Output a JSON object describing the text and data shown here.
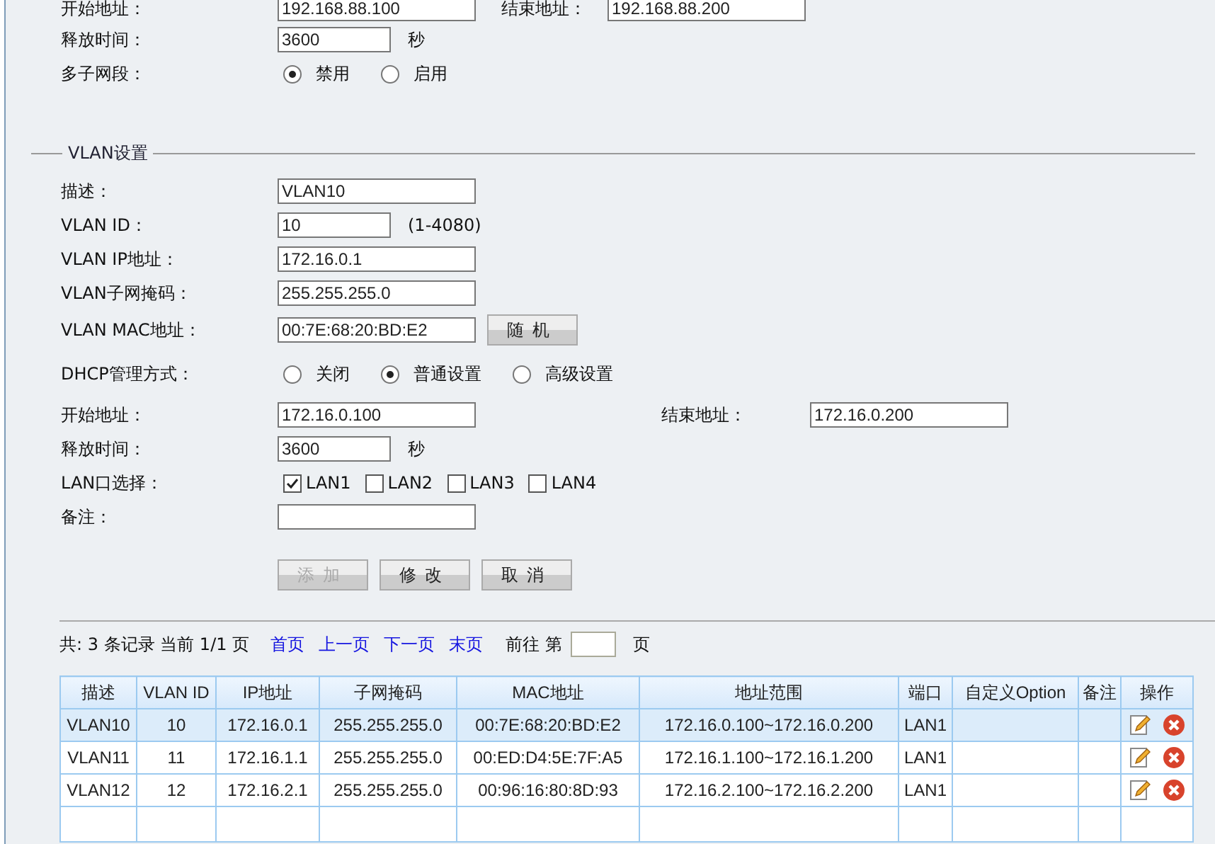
{
  "dhcp_basic": {
    "start_label": "开始地址：",
    "start_value": "192.168.88.100",
    "end_label": "结束地址：",
    "end_value": "192.168.88.200",
    "lease_label": "释放时间：",
    "lease_value": "3600",
    "lease_unit": "秒",
    "multi_label": "多子网段：",
    "multi_options": [
      {
        "label": "禁用",
        "selected": true
      },
      {
        "label": "启用",
        "selected": false
      }
    ]
  },
  "vlan": {
    "legend": "VLAN设置",
    "rows": [
      {
        "kind": "text",
        "label": "描述：",
        "value": "VLAN10"
      },
      {
        "kind": "short",
        "label": "VLAN ID：",
        "value": "10",
        "hint": "(1-4080)"
      },
      {
        "kind": "text",
        "label": "VLAN IP地址：",
        "value": "172.16.0.1"
      },
      {
        "kind": "text",
        "label": "VLAN子网掩码：",
        "value": "255.255.255.0"
      },
      {
        "kind": "button",
        "label": "VLAN MAC地址：",
        "value": "00:7E:68:20:BD:E2",
        "button": "随机"
      },
      {
        "kind": "radio",
        "label": "DHCP管理方式：",
        "options": [
          {
            "label": "关闭",
            "selected": false
          },
          {
            "label": "普通设置",
            "selected": true
          },
          {
            "label": "高级设置",
            "selected": false
          }
        ]
      },
      {
        "kind": "pair",
        "label": "开始地址：",
        "value": "172.16.0.100",
        "end_label": "结束地址：",
        "end_value": "172.16.0.200"
      },
      {
        "kind": "short",
        "label": "释放时间：",
        "value": "3600",
        "hint": "秒"
      },
      {
        "kind": "checks",
        "label": "LAN口选择：",
        "options": [
          {
            "label": "LAN1",
            "checked": true
          },
          {
            "label": "LAN2",
            "checked": false
          },
          {
            "label": "LAN3",
            "checked": false
          },
          {
            "label": "LAN4",
            "checked": false
          }
        ]
      },
      {
        "kind": "text",
        "label": "备注：",
        "value": ""
      }
    ],
    "buttons": [
      {
        "label": "添加",
        "disabled": true
      },
      {
        "label": "修改",
        "disabled": false
      },
      {
        "label": "取消",
        "disabled": false
      }
    ]
  },
  "pagination": {
    "summary": "共: 3 条记录 当前 1/1 页",
    "links": [
      "首页",
      "上一页",
      "下一页",
      "末页"
    ],
    "goto_label": "前往 第",
    "goto_unit": "页"
  },
  "table": {
    "columns": [
      "描述",
      "VLAN ID",
      "IP地址",
      "子网掩码",
      "MAC地址",
      "地址范围",
      "端口",
      "自定义Option",
      "备注",
      "操作"
    ],
    "rows": [
      {
        "selected": true,
        "cells": [
          "VLAN10",
          "10",
          "172.16.0.1",
          "255.255.255.0",
          "00:7E:68:20:BD:E2",
          "172.16.0.100~172.16.0.200",
          "LAN1",
          "",
          ""
        ]
      },
      {
        "selected": false,
        "cells": [
          "VLAN11",
          "11",
          "172.16.1.1",
          "255.255.255.0",
          "00:ED:D4:5E:7F:A5",
          "172.16.1.100~172.16.1.200",
          "LAN1",
          "",
          ""
        ]
      },
      {
        "selected": false,
        "cells": [
          "VLAN12",
          "12",
          "172.16.2.1",
          "255.255.255.0",
          "00:96:16:80:8D:93",
          "172.16.2.100~172.16.2.200",
          "LAN1",
          "",
          ""
        ]
      }
    ]
  }
}
